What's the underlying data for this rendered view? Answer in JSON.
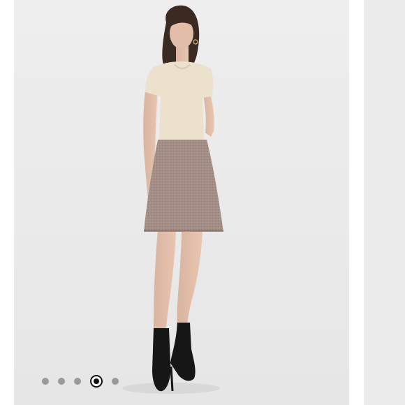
{
  "carousel": {
    "slide_count": 5,
    "active_index": 3,
    "photo_description_icon": "model-photo-icon",
    "colors": {
      "background": "#ececec",
      "dot_inactive": "#9a9a9a",
      "dot_active": "#111111"
    }
  }
}
